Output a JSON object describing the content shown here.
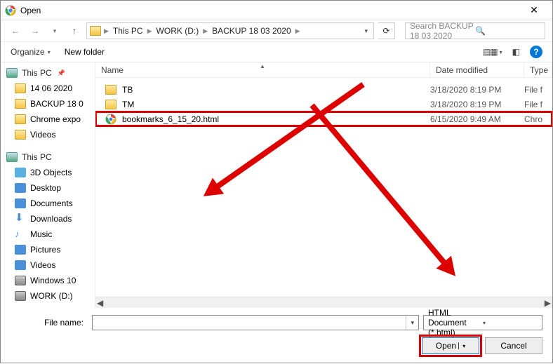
{
  "title": "Open",
  "breadcrumb": [
    "This PC",
    "WORK (D:)",
    "BACKUP 18 03 2020"
  ],
  "search_placeholder": "Search BACKUP 18 03 2020",
  "toolbar": {
    "organize": "Organize",
    "newfolder": "New folder"
  },
  "sidebar": {
    "qa": {
      "label": "This PC"
    },
    "qa_items": [
      {
        "label": "14 06 2020",
        "icon": "folder"
      },
      {
        "label": "BACKUP 18 0",
        "icon": "folder"
      },
      {
        "label": "Chrome expo",
        "icon": "folder"
      },
      {
        "label": "Videos",
        "icon": "folder"
      }
    ],
    "pc": {
      "label": "This PC"
    },
    "pc_items": [
      {
        "label": "3D Objects",
        "icon": "3d"
      },
      {
        "label": "Desktop",
        "icon": "desktop"
      },
      {
        "label": "Documents",
        "icon": "docs"
      },
      {
        "label": "Downloads",
        "icon": "dl"
      },
      {
        "label": "Music",
        "icon": "music"
      },
      {
        "label": "Pictures",
        "icon": "pic"
      },
      {
        "label": "Videos",
        "icon": "vid"
      },
      {
        "label": "Windows 10",
        "icon": "win"
      },
      {
        "label": "WORK (D:)",
        "icon": "drive"
      }
    ]
  },
  "columns": {
    "name": "Name",
    "date": "Date modified",
    "type": "Type"
  },
  "files": [
    {
      "name": "TB",
      "date": "3/18/2020 8:19 PM",
      "type": "File f",
      "icon": "folder",
      "hl": false
    },
    {
      "name": "TM",
      "date": "3/18/2020 8:19 PM",
      "type": "File f",
      "icon": "folder",
      "hl": false
    },
    {
      "name": "bookmarks_6_15_20.html",
      "date": "6/15/2020 9:49 AM",
      "type": "Chro",
      "icon": "html",
      "hl": true
    }
  ],
  "footer": {
    "fname_label": "File name:",
    "fname_value": "",
    "filter": "HTML Document (*.html)",
    "open": "Open",
    "cancel": "Cancel"
  }
}
